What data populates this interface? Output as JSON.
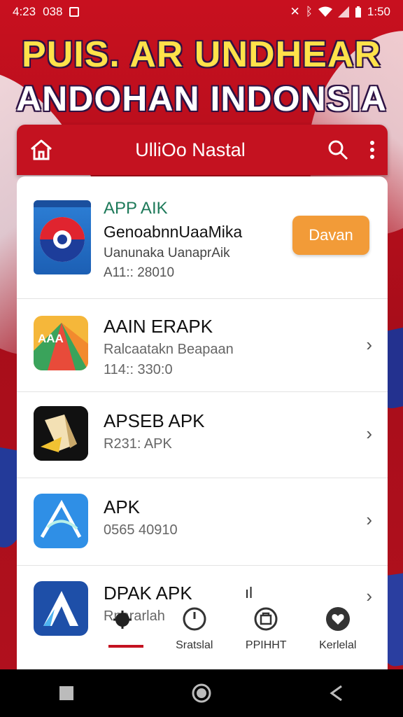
{
  "status_bar": {
    "time": "4:23",
    "extra": "038",
    "right_text": "1:50"
  },
  "banner": {
    "line1": "PUIS. AR UNDHEAR",
    "line2": "ANDOHAN INDONSIA"
  },
  "appbar": {
    "title": "UlliOo Nastal"
  },
  "featured": {
    "label": "APP AIK",
    "name": "GenoabnnUaaMika",
    "developer": "Uanunaka UanaprAik",
    "meta": "A11:: 28010",
    "button": "Davan"
  },
  "apps": [
    {
      "name": "AAIN ERAPK",
      "line1": "Ralcaatakn Beapaan",
      "line2": "114:: 330:0",
      "icon_text": "AAA"
    },
    {
      "name": "APSEB APK",
      "line1": "R231: APK",
      "line2": ""
    },
    {
      "name": "APK",
      "line1": "0565 40910",
      "line2": ""
    },
    {
      "name": "DPAK APK",
      "line1": "Rnararlah",
      "line2": "",
      "extra": "ıl"
    }
  ],
  "tabs": [
    {
      "label": ""
    },
    {
      "label": "Sratslal"
    },
    {
      "label": "PPIHHT"
    },
    {
      "label": "Kerlelal"
    }
  ],
  "colors": {
    "brand_red": "#c41220",
    "accent_orange": "#f29b38",
    "headline_yellow": "#ffe24a"
  }
}
